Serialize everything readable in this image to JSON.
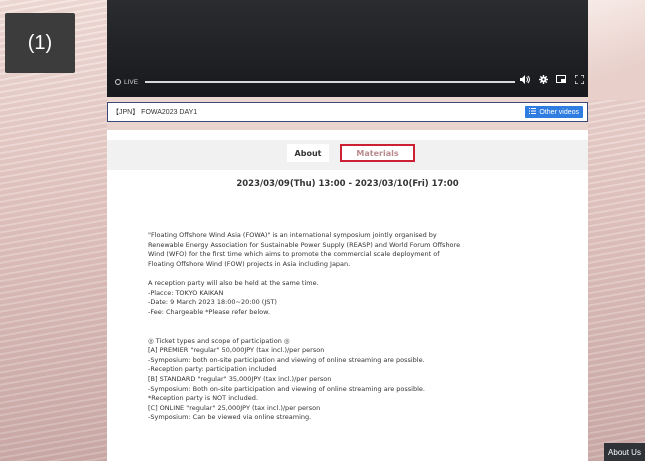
{
  "step_badge": "(1)",
  "video": {
    "live_label": "LIVE",
    "icons": [
      "volume-icon",
      "gear-icon",
      "pip-icon",
      "fullscreen-icon"
    ]
  },
  "title_bar": {
    "title": "【JPN】 FOWA2023 DAY1",
    "other_videos_label": "Other videos"
  },
  "tabs": [
    {
      "label": "About"
    },
    {
      "label": "Materials"
    }
  ],
  "date_range": "2023/03/09(Thu) 13:00 - 2023/03/10(Fri) 17:00",
  "description": [
    "\"Floating Offshore Wind Asia (FOWA)\" is an international symposium jointly organised by",
    "Renewable Energy Association for Sustainable Power Supply (REASP) and World Forum Offshore",
    "Wind (WFO) for the first time which aims to promote the commercial scale deployment of",
    "Floating Offshore Wind (FOW) projects in Asia including Japan.",
    "",
    "A reception party will also be held at the same time.",
    "-Placce: TOKYO KAIKAN",
    "-Date: 9 March 2023 18:00~20:00 (JST)",
    "-Fee: Chargeable *Please refer below.",
    "",
    "",
    "◎ Ticket types and scope of participation ◎",
    "[A] PREMIER \"regular\" 50,000JPY (tax incl.)/per person",
    " -Symposium: both on-site participation and viewing of online streaming are possible.",
    " -Reception party: participation included",
    "[B] STANDARD \"regular\" 35,000JPY (tax incl.)/per person",
    " -Symposium: Both on-site participation and viewing of online streaming are possible.",
    " *Reception party is NOT included.",
    "[C] ONLINE \"regular\" 25,000JPY (tax incl.)/per person",
    " -Symposium: Can be viewed via online streaming."
  ],
  "about_us": "About Us",
  "colors": {
    "accent_blue": "#2f7de1",
    "highlight_red": "#cc2035"
  }
}
